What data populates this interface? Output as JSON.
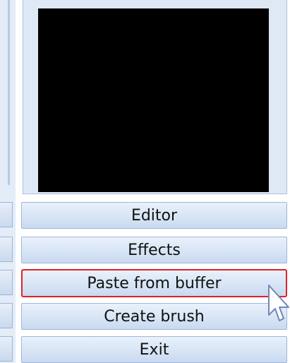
{
  "menu": {
    "editor_label": "Editor",
    "effects_label": "Effects",
    "paste_label": "Paste from buffer",
    "create_brush_label": "Create brush",
    "exit_label": "Exit"
  },
  "colors": {
    "highlight_border": "#e0222a",
    "preview_background": "#000000",
    "button_border": "#9fb7d8"
  },
  "icons": {
    "cursor": "mouse-pointer-icon"
  }
}
